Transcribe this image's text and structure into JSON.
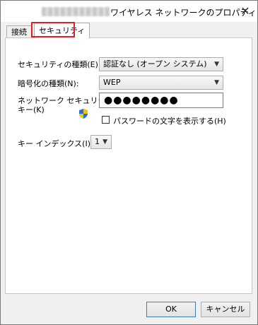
{
  "window": {
    "title": "ワイヤレス ネットワークのプロパティ"
  },
  "tabs": [
    {
      "label": "接続"
    },
    {
      "label": "セキュリティ"
    }
  ],
  "security": {
    "type_label": "セキュリティの種類(E):",
    "type_value": "認証なし (オープン システム)",
    "encryption_label": "暗号化の種類(N):",
    "encryption_value": "WEP",
    "key_label_line1": "ネットワーク セキュリティ",
    "key_label_line2": "キー(K)",
    "key_value": "●●●●●●●●",
    "show_chars_label": "パスワードの文字を表示する(H)",
    "key_index_label": "キー インデックス(I):",
    "key_index_value": "1"
  },
  "buttons": {
    "ok": "OK",
    "cancel": "キャンセル"
  },
  "colors": {
    "highlight": "#e31f26",
    "shield_blue": "#2b6fd0",
    "shield_yellow": "#f2c21b"
  }
}
